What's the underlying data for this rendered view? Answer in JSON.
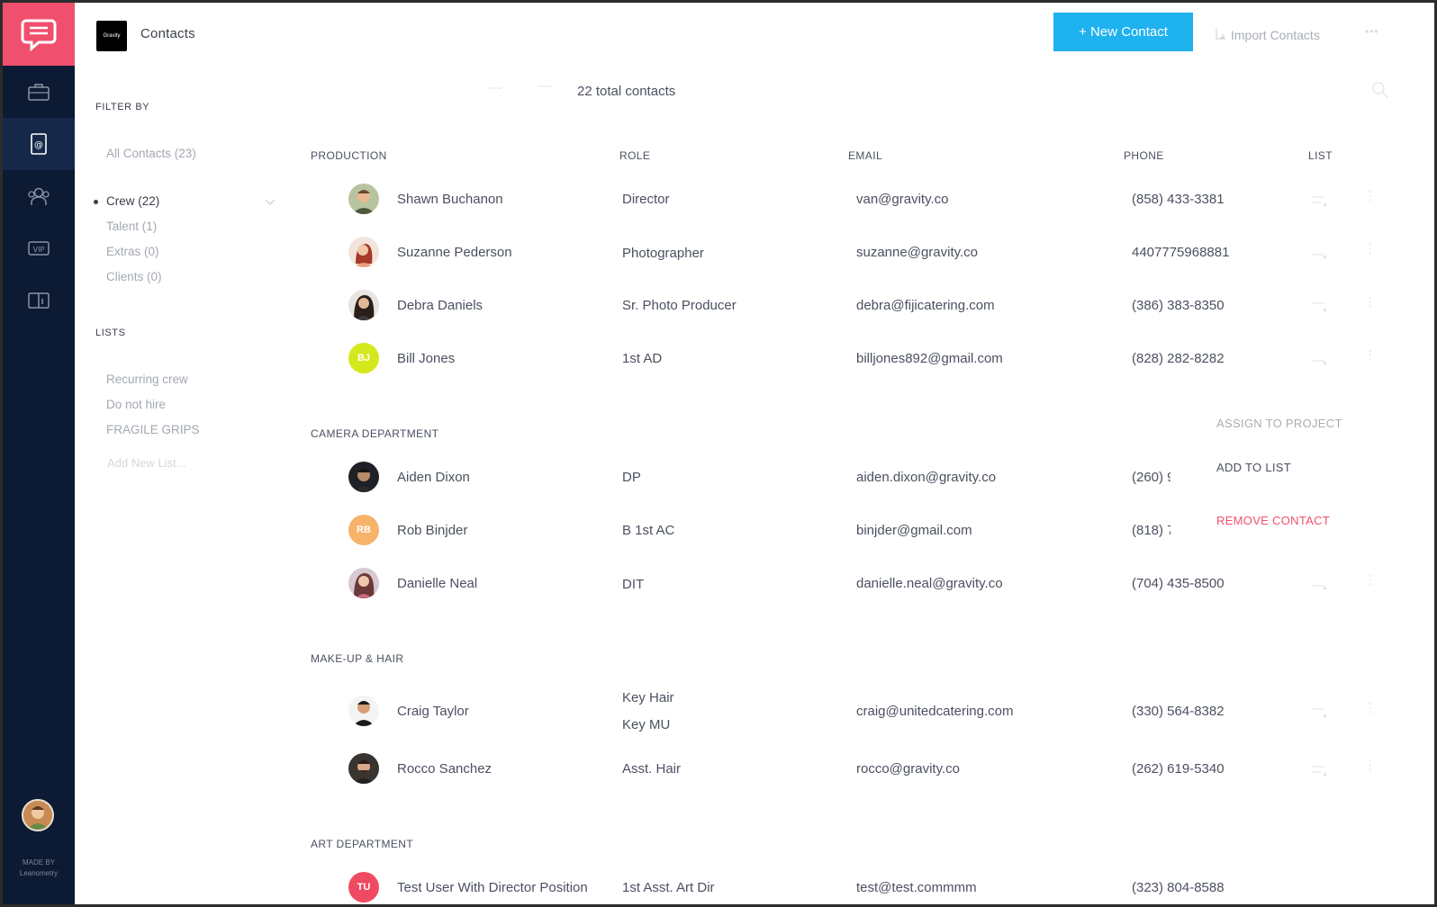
{
  "header": {
    "brand_logo_text": "Gravity",
    "title": "Contacts",
    "new_contact_label": "+ New Contact",
    "import_label": "Import Contacts",
    "total_label": "22 total contacts"
  },
  "colors": {
    "accent": "#1eb2ef",
    "brand": "#f0506e",
    "sidebar": "#0c1a33",
    "danger": "#f0506e"
  },
  "rail": {
    "icons": [
      "chat-logo-icon",
      "briefcase-icon",
      "contacts-book-icon",
      "group-icon",
      "vip-icon",
      "book-icon"
    ],
    "made_by_line1": "MADE BY",
    "made_by_line2": "Leanometry"
  },
  "filter": {
    "heading": "FILTER BY",
    "all": "All Contacts (23)",
    "crew": "Crew (22)",
    "talent": "Talent (1)",
    "extras": "Extras (0)",
    "clients": "Clients (0)"
  },
  "lists": {
    "heading": "LISTS",
    "items": [
      "Recurring crew",
      "Do not hire",
      "FRAGILE GRIPS"
    ],
    "add_new": "Add New List..."
  },
  "columns": {
    "role": "ROLE",
    "email": "EMAIL",
    "phone": "PHONE",
    "list": "LIST"
  },
  "sections": [
    {
      "title": "PRODUCTION",
      "rows": [
        {
          "name": "Shawn Buchanon",
          "role": "Director",
          "email": "van@gravity.co",
          "phone": "(858) 433-3381"
        },
        {
          "name": "Suzanne Pederson",
          "role": "Photographer",
          "email": "suzanne@gravity.co",
          "phone": "4407775968881"
        },
        {
          "name": "Debra Daniels",
          "role": "Sr. Photo Producer",
          "email": "debra@fijicatering.com",
          "phone": "(386) 383-8350"
        },
        {
          "name": "Bill Jones",
          "initials": "BJ",
          "role": "1st AD",
          "email": "billjones892@gmail.com",
          "phone": "(828) 282-8282"
        }
      ]
    },
    {
      "title": "CAMERA DEPARTMENT",
      "rows": [
        {
          "name": "Aiden Dixon",
          "role": "DP",
          "email": "aiden.dixon@gravity.co",
          "phone": "(260) 9"
        },
        {
          "name": "Rob Binjder",
          "initials": "RB",
          "role": "B 1st AC",
          "email": "binjder@gmail.com",
          "phone": "(818) 7"
        },
        {
          "name": "Danielle Neal",
          "role": "DIT",
          "email": "danielle.neal@gravity.co",
          "phone": "(704) 435-8500"
        }
      ]
    },
    {
      "title": "MAKE-UP & HAIR",
      "rows": [
        {
          "name": "Craig Taylor",
          "role": "Key Hair",
          "role2": "Key MU",
          "email": "craig@unitedcatering.com",
          "phone": "(330) 564-8382"
        },
        {
          "name": "Rocco Sanchez",
          "role": "Asst. Hair",
          "email": "rocco@gravity.co",
          "phone": "(262) 619-5340"
        }
      ]
    },
    {
      "title": "ART DEPARTMENT",
      "rows": [
        {
          "name": "Test User With Director Position",
          "initials": "TU",
          "role": "1st Asst. Art Dir",
          "email": "test@test.commmm",
          "phone": "(323) 804-8588"
        }
      ]
    }
  ],
  "context_menu": {
    "assign": "ASSIGN TO PROJECT",
    "add_to_list": "ADD TO LIST",
    "remove": "REMOVE CONTACT"
  }
}
